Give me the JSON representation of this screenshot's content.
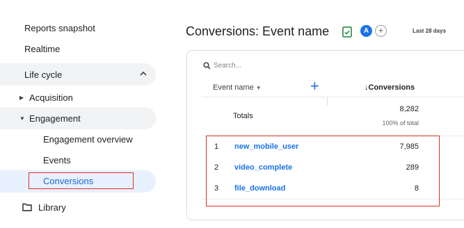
{
  "sidebar": {
    "reports_snapshot": "Reports snapshot",
    "realtime": "Realtime",
    "life_cycle": "Life cycle",
    "acquisition": "Acquisition",
    "engagement": "Engagement",
    "engagement_overview": "Engagement overview",
    "events": "Events",
    "conversions": "Conversions",
    "library": "Library"
  },
  "header": {
    "title": "Conversions: Event name",
    "avatar_letter": "A",
    "add_comparison": "+",
    "date_range": "Last 28 days"
  },
  "table": {
    "search_placeholder": "Search...",
    "col_event_name": "Event name",
    "col_conversions": "↓Conversions",
    "totals_label": "Totals",
    "totals_value": "8,282",
    "totals_pct": "100% of total",
    "rows": [
      {
        "num": "1",
        "name": "new_mobile_user",
        "value": "7,985"
      },
      {
        "num": "2",
        "name": "video_complete",
        "value": "289"
      },
      {
        "num": "3",
        "name": "file_download",
        "value": "8"
      }
    ]
  },
  "colors": {
    "accent_blue": "#1a73e8",
    "highlight_red": "#d93025",
    "selected_bg": "#e8f0fe",
    "hover_bg": "#f1f3f4"
  }
}
